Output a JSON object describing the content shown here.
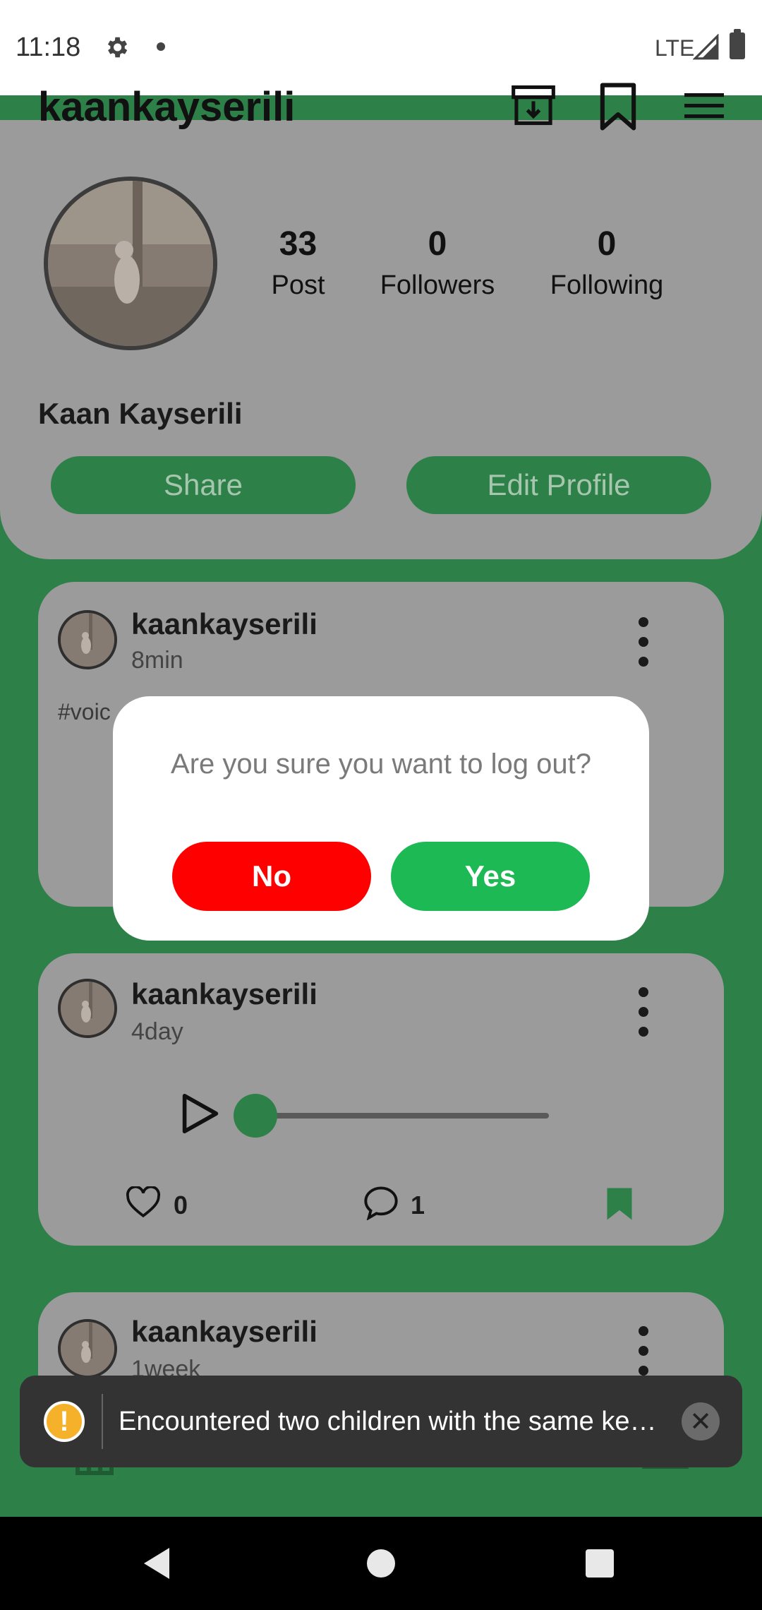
{
  "status_bar": {
    "time": "11:18",
    "network": "LTE"
  },
  "header": {
    "username": "kaankayserili"
  },
  "profile": {
    "stats": [
      {
        "count": "33",
        "label": "Post"
      },
      {
        "count": "0",
        "label": "Followers"
      },
      {
        "count": "0",
        "label": "Following"
      }
    ],
    "name": "Kaan Kayserili",
    "share_label": "Share",
    "edit_label": "Edit Profile"
  },
  "posts": [
    {
      "user": "kaankayserili",
      "time": "8min",
      "hashtag": "#voic"
    },
    {
      "user": "kaankayserili",
      "time": "4day",
      "likes": "0",
      "comments": "1",
      "progress": 0
    },
    {
      "user": "kaankayserili",
      "time": "1week"
    }
  ],
  "dialog": {
    "message": "Are you sure you want to log out?",
    "no_label": "No",
    "yes_label": "Yes",
    "no_color": "#ff0000",
    "yes_color": "#1db954"
  },
  "toast": {
    "message": "Encountered two children with the same ke…"
  },
  "colors": {
    "brand_green": "#2e8049",
    "card_gray": "#9b9b9b"
  }
}
